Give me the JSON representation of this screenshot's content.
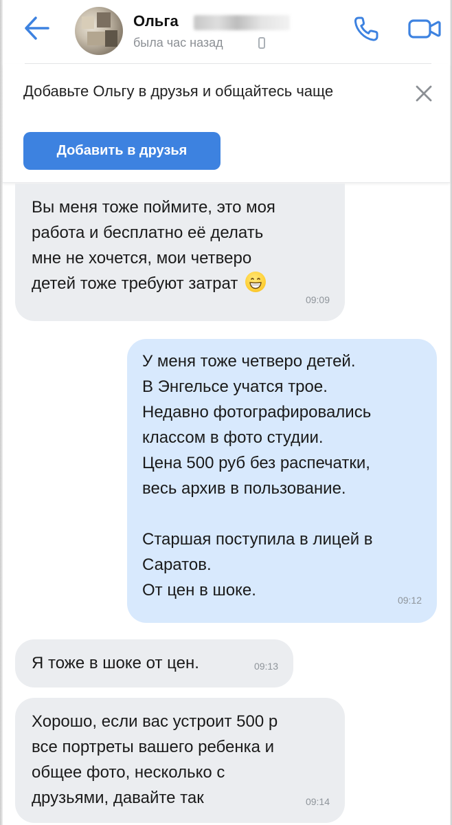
{
  "header": {
    "contact_name": "Ольга",
    "status": "была час назад"
  },
  "banner": {
    "text": "Добавьте Ольгу в друзья и общайтесь чаще",
    "button_label": "Добавить в друзья"
  },
  "messages": [
    {
      "direction": "incoming",
      "text": "Вы меня тоже поймите, это моя\nработа и бесплатно её делать\nмне не хочется, мои четверо\nдетей тоже требуют затрат",
      "emoji": "grinning-face",
      "time": "09:09"
    },
    {
      "direction": "outgoing",
      "text": "У меня тоже четверо детей.\nВ Энгельсе учатся трое.\nНедавно фотографировались\nклассом в фото студии.\nЦена 500 руб без распечатки,\nвесь архив в пользование.\n\nСтаршая поступила в лицей в\nСаратов.\nОт цен в шоке.",
      "time": "09:12"
    },
    {
      "direction": "incoming",
      "text": "Я тоже в шоке от цен.",
      "time": "09:13"
    },
    {
      "direction": "incoming",
      "text": "Хорошо, если вас устроит 500 р\nвсе портреты вашего ребенка и\nобщее фото, несколько с\nдрузьями, давайте так",
      "time": "09:14"
    }
  ],
  "colors": {
    "accent": "#3d82e0",
    "incoming_bubble": "#ebedf0",
    "outgoing_bubble": "#d8e9fd",
    "secondary_text": "#8b8f94"
  },
  "icons": {
    "back": "arrow-left-icon",
    "call": "phone-icon",
    "video": "video-camera-icon",
    "close": "close-icon",
    "device": "mobile-device-icon"
  }
}
